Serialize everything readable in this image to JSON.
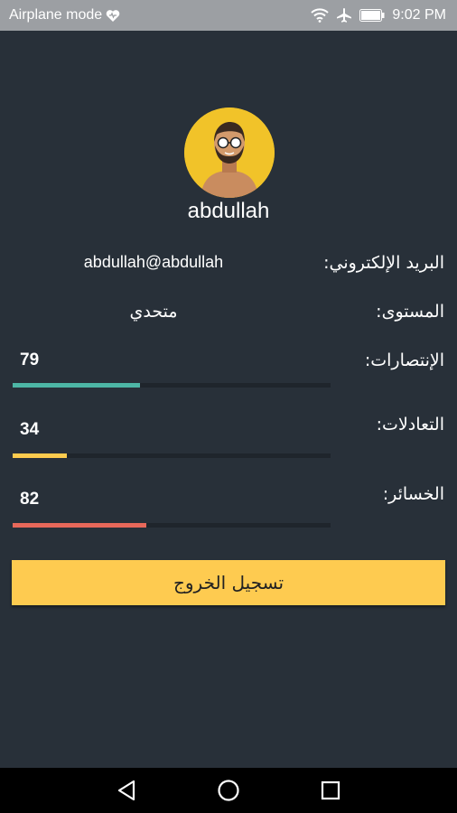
{
  "status_bar": {
    "mode_text": "Airplane mode",
    "time": "9:02 PM",
    "icons": [
      "heart-icon",
      "wifi-icon",
      "airplane-icon",
      "battery-icon"
    ]
  },
  "profile": {
    "username": "abdullah",
    "avatar_icon": "user-avatar-icon"
  },
  "details": {
    "email_label": "البريد الإلكتروني:",
    "email_value": "abdullah@abdullah",
    "level_label": "المستوى:",
    "level_value": "متحدي"
  },
  "stats": [
    {
      "label": "الإنتصارات:",
      "value": "79",
      "fill_fraction": 0.4,
      "color": "#4db6a6"
    },
    {
      "label": "التعادلات:",
      "value": "34",
      "fill_fraction": 0.17,
      "color": "#fdcb4e"
    },
    {
      "label": "الخسائر:",
      "value": "82",
      "fill_fraction": 0.42,
      "color": "#e8685a"
    }
  ],
  "logout_label": "تسجيل الخروج",
  "nav_bar": {
    "icons": [
      "back-triangle-icon",
      "home-circle-icon",
      "recents-square-icon"
    ]
  },
  "colors": {
    "background": "#283039",
    "accent": "#fecb50"
  }
}
